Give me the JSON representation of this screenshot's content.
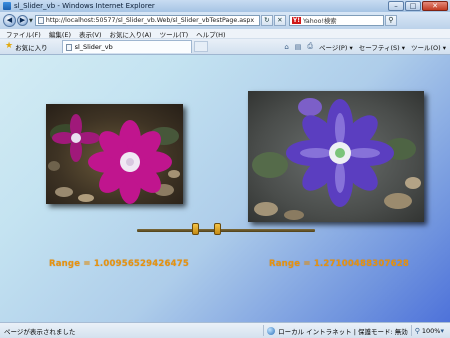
{
  "window": {
    "title": "sl_Slider_vb - Windows Internet Explorer",
    "minimize": "–",
    "maximize": "□",
    "close": "✕"
  },
  "address": {
    "back": "◀",
    "forward": "▶",
    "url": "http://localhost:50577/sl_Slider_vb.Web/sl_Slider_vbTestPage.aspx",
    "refresh": "↻",
    "stop": "✕",
    "search_engine_logo": "Y!",
    "search_label": "Yahoo!検索",
    "search_go": "⚲"
  },
  "menu": {
    "items": [
      "ファイル(F)",
      "編集(E)",
      "表示(V)",
      "お気に入り(A)",
      "ツール(T)",
      "ヘルプ(H)"
    ]
  },
  "tabs": {
    "favorites_label": "お気に入り",
    "active_tab_title": "sl_Slider_vb",
    "commands": [
      "ページ(P) ▾",
      "セーフティ(S) ▾",
      "ツール(O) ▾"
    ]
  },
  "content": {
    "range_left": "Range = 1.00956529426475",
    "range_right": "Range = 1.27100488307628",
    "slider": {
      "thumb1_value": 0.33,
      "thumb2_value": 0.45
    }
  },
  "status": {
    "text": "ページが表示されました",
    "zone": "ローカル イントラネット | 保護モード: 無効",
    "zoom": "100%"
  },
  "colors": {
    "range_text": "#e8930c",
    "content_bg_start": "#d3ecf4",
    "content_bg_end": "#4e72da"
  }
}
